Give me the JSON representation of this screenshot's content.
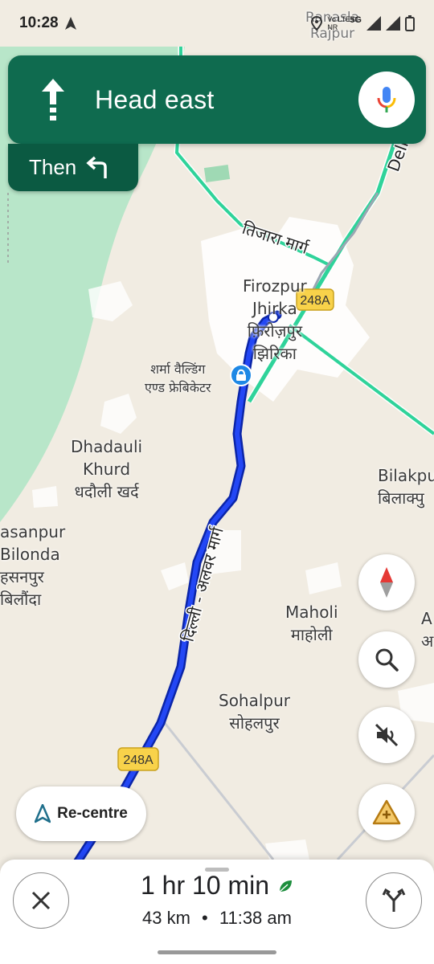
{
  "status_bar": {
    "time": "10:28",
    "network": "5G",
    "carrier": "Vo LTE\nNR"
  },
  "navigation": {
    "instruction": "Head east",
    "then_label": "Then",
    "icons": {
      "direction": "straight-arrow-icon",
      "then": "turn-left-icon",
      "mic": "mic-icon"
    }
  },
  "map": {
    "road_badges": [
      "248A",
      "248A"
    ],
    "roads": [
      "तिजारा मार्ग",
      "दिल्ली - अलवर मार्ग",
      "Dell"
    ],
    "places": [
      {
        "lines": [
          "Ranasla",
          "Rajpur"
        ]
      },
      {
        "lines": [
          "Firozpur",
          "Jhirka",
          "फ़िरोज़पुर",
          "झिरिका"
        ]
      },
      {
        "lines": [
          "शर्मा वैल्डिंग",
          "एण्ड फ्रेबिकेटर"
        ]
      },
      {
        "lines": [
          "Dhadauli",
          "Khurd",
          "धदौली खर्द"
        ]
      },
      {
        "lines": [
          "Bilakpu",
          "बिलाक्पु"
        ]
      },
      {
        "lines": [
          "asanpur",
          "Bilonda",
          "हसनपुर",
          "बिलौंदा"
        ]
      },
      {
        "lines": [
          "Maholi",
          "माहोली"
        ]
      },
      {
        "lines": [
          "Sohalpur",
          "सोहलपुर"
        ]
      },
      {
        "lines": [
          "A",
          "अ"
        ]
      }
    ]
  },
  "controls": {
    "recenter_label": "Re-centre",
    "compass": "compass-icon",
    "search": "search-icon",
    "mute": "volume-off-icon",
    "report": "report-incident-icon"
  },
  "trip": {
    "duration": "1 hr 10 min",
    "distance": "43 km",
    "separator": "•",
    "arrival": "11:38 am",
    "eco_icon": "leaf-icon",
    "close_icon": "close-icon",
    "routes_icon": "alternate-routes-icon"
  },
  "colors": {
    "header": "#0f6b4f",
    "then_card": "#0b5a42",
    "route": "#1a3bdb",
    "highway": "#2fd39a",
    "forest": "#b7e6c8",
    "land": "#f1ece2"
  }
}
